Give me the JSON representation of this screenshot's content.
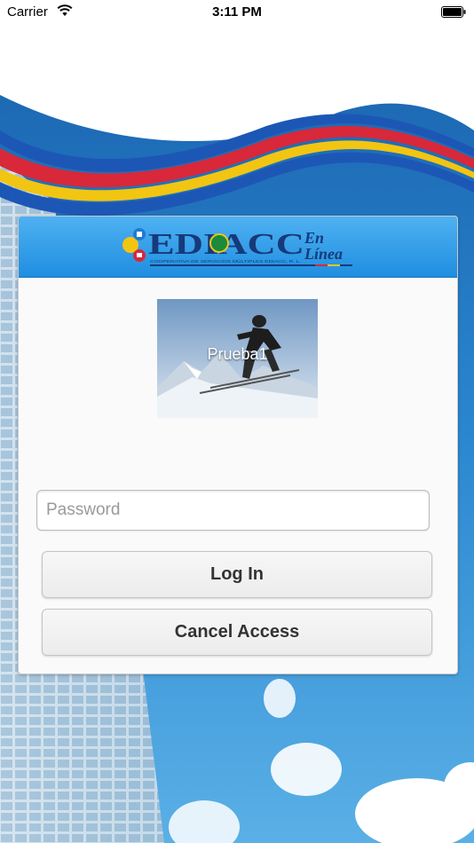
{
  "status_bar": {
    "carrier": "Carrier",
    "time": "3:11 PM"
  },
  "header": {
    "logo_text": "EDIACC",
    "logo_subtext": "En Línea",
    "logo_tagline": "COOPERATIVA DE SERVICIOS MÚLTIPLES EDIACC, R. L."
  },
  "profile": {
    "name": "Prueba1"
  },
  "form": {
    "password_placeholder": "Password",
    "password_value": "",
    "login_label": "Log In",
    "cancel_label": "Cancel Access"
  },
  "colors": {
    "header_blue": "#2a9be6",
    "stripe_red": "#d8283a",
    "stripe_yellow": "#f2c512",
    "stripe_blue": "#1d57b5"
  }
}
